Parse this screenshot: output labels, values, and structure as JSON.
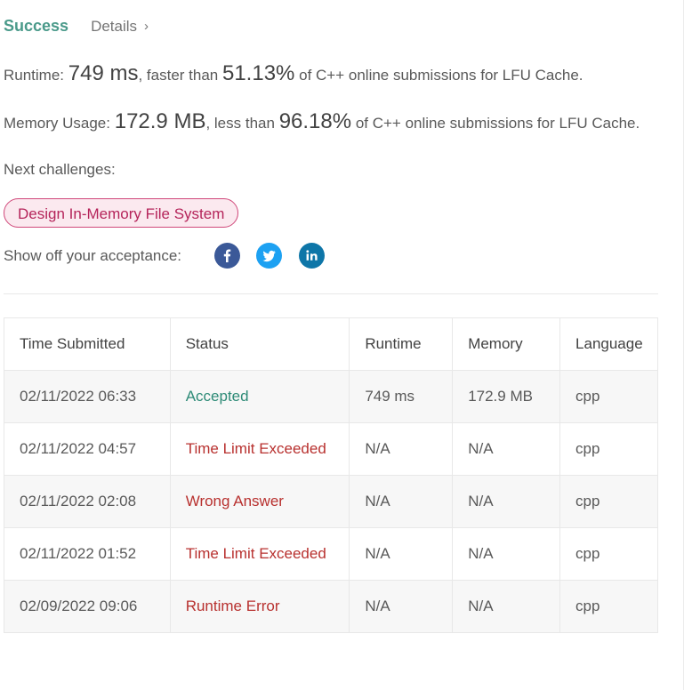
{
  "header": {
    "status": "Success",
    "details_label": "Details"
  },
  "runtime": {
    "label": "Runtime:",
    "value": "749 ms",
    "comparison": ", faster than",
    "percent": "51.13%",
    "suffix": "of C++ online submissions for LFU Cache."
  },
  "memory": {
    "label": "Memory Usage:",
    "value": "172.9 MB",
    "comparison": ", less than",
    "percent": "96.18%",
    "suffix": "of C++ online submissions for LFU Cache."
  },
  "next": {
    "label": "Next challenges:",
    "challenge": "Design In-Memory File System"
  },
  "share": {
    "label": "Show off your acceptance:",
    "icons": [
      "facebook-icon",
      "twitter-icon",
      "linkedin-icon"
    ]
  },
  "table": {
    "headers": [
      "Time Submitted",
      "Status",
      "Runtime",
      "Memory",
      "Language"
    ],
    "rows": [
      {
        "time": "02/11/2022 06:33",
        "status": "Accepted",
        "runtime": "749 ms",
        "memory": "172.9 MB",
        "language": "cpp"
      },
      {
        "time": "02/11/2022 04:57",
        "status": "Time Limit Exceeded",
        "runtime": "N/A",
        "memory": "N/A",
        "language": "cpp"
      },
      {
        "time": "02/11/2022 02:08",
        "status": "Wrong Answer",
        "runtime": "N/A",
        "memory": "N/A",
        "language": "cpp"
      },
      {
        "time": "02/11/2022 01:52",
        "status": "Time Limit Exceeded",
        "runtime": "N/A",
        "memory": "N/A",
        "language": "cpp"
      },
      {
        "time": "02/09/2022 09:06",
        "status": "Runtime Error",
        "runtime": "N/A",
        "memory": "N/A",
        "language": "cpp"
      }
    ]
  },
  "colors": {
    "success": "#4a9a8a",
    "accepted": "#2e8b77",
    "error": "#b8312f",
    "challenge_border": "#d0487a"
  }
}
